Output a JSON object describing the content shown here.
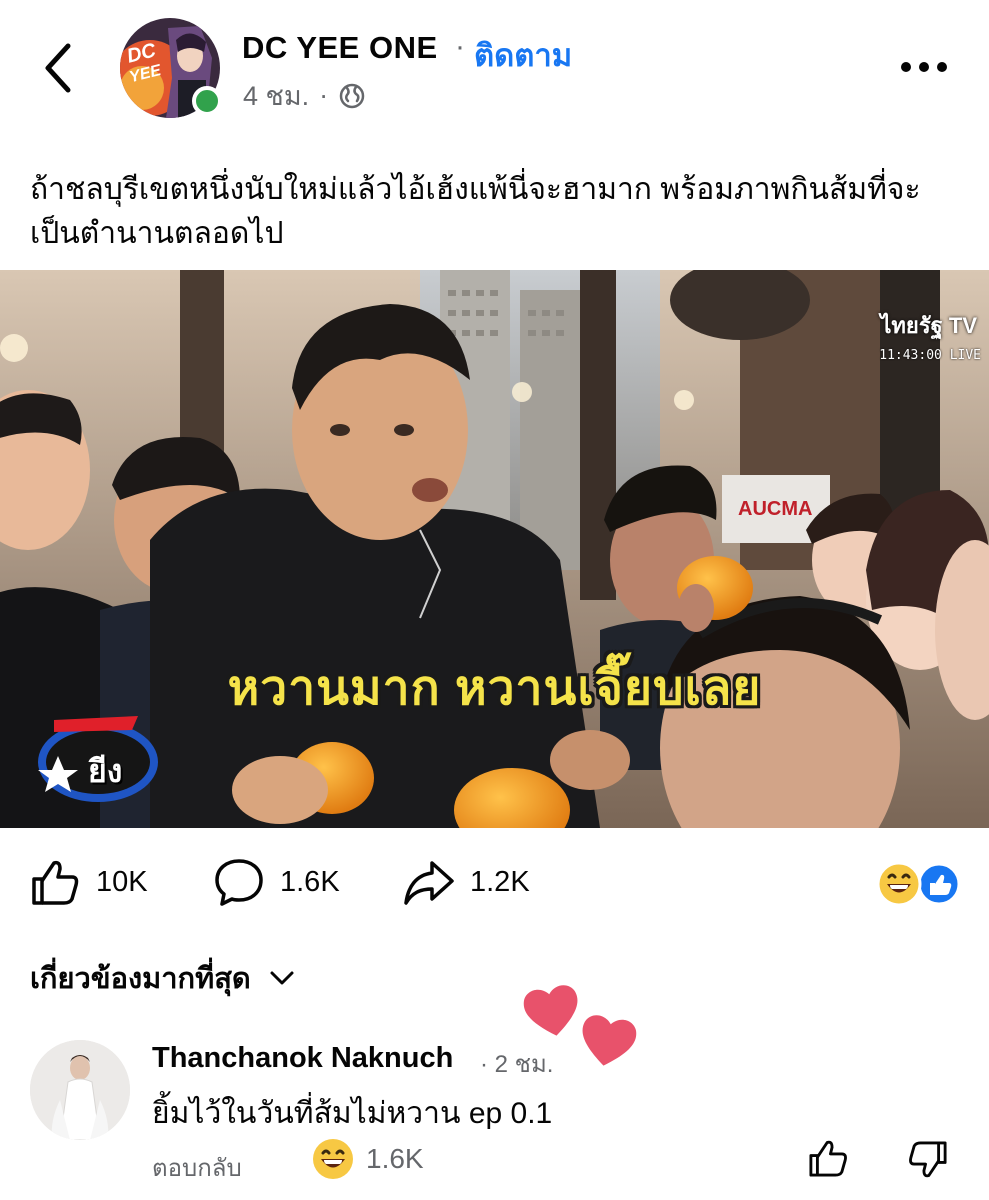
{
  "post": {
    "page_name": "DC YEE ONE",
    "follow_separator": "·",
    "follow_label": "ติดตาม",
    "time": "4 ชม.",
    "time_separator": "·",
    "caption": "ถ้าชลบุรีเขตหนึ่งนับใหม่แล้วไอ้เฮ้งแพ้นี่จะฮามาก พร้อมภาพกินส้มที่จะเป็นตำนานตลอดไป"
  },
  "media": {
    "subtitle": "หวานมาก หวานเจี๊ยบเลย",
    "tv_logo": "ไทยรัฐ TV",
    "tv_time": "11:43:00  LIVE",
    "store_sign": "AUCMA",
    "show_logo": "ยีง"
  },
  "actions": {
    "likes": "10K",
    "comments": "1.6K",
    "shares": "1.2K"
  },
  "comments_section": {
    "sort_label": "เกี่ยวข้องมากที่สุด"
  },
  "comment": {
    "author": "Thanchanok Naknuch",
    "time": "· 2 ชม.",
    "text": "ยิ้มไว้ในวันที่ส้มไม่หวาน ep 0.1",
    "reply_label": "ตอบกลับ",
    "reaction_count": "1.6K"
  },
  "colors": {
    "accent": "#1877f2",
    "online": "#31a24c",
    "muted": "#65676b",
    "subtitle": "#f5e34a",
    "heart": "#e8526b"
  }
}
